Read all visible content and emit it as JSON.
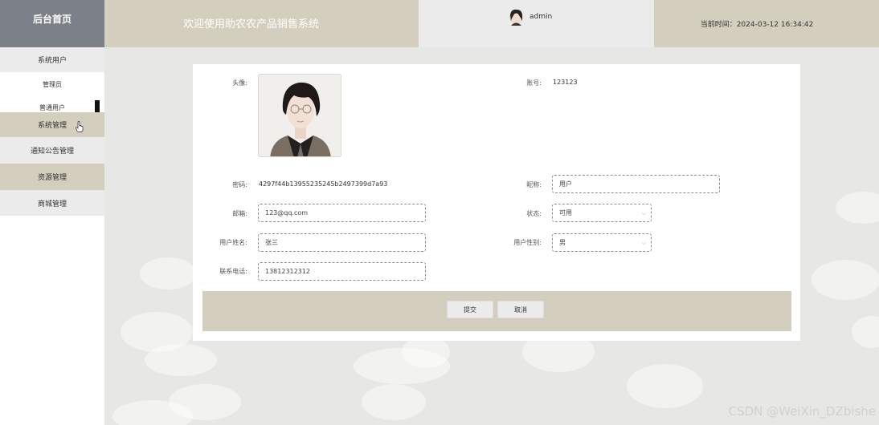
{
  "header": {
    "home_label": "后台首页",
    "welcome": "欢迎使用助农农产品销售系统",
    "username": "admin",
    "current_time": "当前时间：2024-03-12 16:34:42"
  },
  "sidebar": {
    "items": [
      {
        "label": "系统用户"
      },
      {
        "label": "管理员"
      },
      {
        "label": "普通用户"
      },
      {
        "label": "系统管理"
      },
      {
        "label": "通知公告管理"
      },
      {
        "label": "资源管理"
      },
      {
        "label": "商城管理"
      }
    ]
  },
  "form": {
    "avatar_label": "头像:",
    "account_label": "账号:",
    "account_value": "123123",
    "password_label": "密码:",
    "password_value": "4297f44b13955235245b2497399d7a93",
    "nickname_label": "昵称:",
    "nickname_value": "用户",
    "email_label": "邮箱:",
    "email_value": "123@qq.com",
    "status_label": "状态:",
    "status_value": "可用",
    "realname_label": "用户姓名:",
    "realname_value": "张三",
    "gender_label": "用户性别:",
    "gender_value": "男",
    "phone_label": "联系电话:",
    "phone_value": "13812312312"
  },
  "actions": {
    "submit": "提交",
    "cancel": "取消"
  },
  "watermark": "CSDN @WeiXin_DZbishe",
  "colors": {
    "brand_bg": "#7c8089",
    "accent_beige": "#d3cebe",
    "light_gray": "#ebebeb",
    "main_bg": "#e7e7e5"
  }
}
